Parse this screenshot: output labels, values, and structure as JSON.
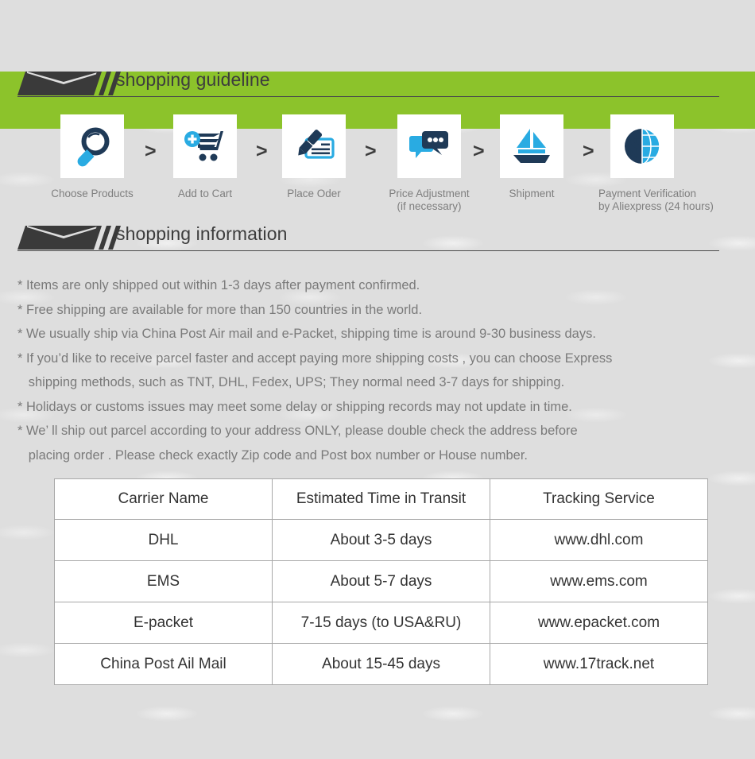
{
  "theme": {
    "banner_color": "#8CC32B",
    "page_background": "#dedede",
    "accent_dark": "#3a3a3a",
    "icon_dark": "#1F3A57",
    "icon_blue": "#29ABE2"
  },
  "banner": {
    "name": "green-header-banner"
  },
  "guideline": {
    "title": "shopping guideline",
    "separator": ">",
    "steps": [
      {
        "icon": "magnifier-icon",
        "label_line1": "Choose Products",
        "label_line2": ""
      },
      {
        "icon": "add-to-cart-icon",
        "label_line1": "Add to Cart",
        "label_line2": ""
      },
      {
        "icon": "pen-check-icon",
        "label_line1": "Place Oder",
        "label_line2": ""
      },
      {
        "icon": "chat-bubbles-icon",
        "label_line1": "Price Adjustment",
        "label_line2": "(if necessary)"
      },
      {
        "icon": "sailboat-icon",
        "label_line1": "Shipment",
        "label_line2": ""
      },
      {
        "icon": "dollar-globe-icon",
        "label_line1": "Payment Verification",
        "label_line2": "by  Aliexpress (24 hours)"
      }
    ]
  },
  "information": {
    "title": "shopping information",
    "lines": [
      "* Items are only shipped out within 1-3 days after payment confirmed.",
      "* Free shipping are available for more than 150 countries in the world.",
      "* We usually ship via China Post Air mail and e-Packet, shipping time is around 9-30 business days.",
      "* If you’d like to receive parcel faster and accept paying more shipping costs , you can choose Express",
      "   shipping methods, such as TNT, DHL, Fedex, UPS; They normal need 3-7 days for shipping.",
      "* Holidays or customs issues may meet some delay or shipping records may not update in time.",
      "* We’ ll ship out parcel according to your address ONLY, please double check the address before",
      "   placing order . Please check exactly Zip code and Post box number or House number."
    ]
  },
  "carrier_table": {
    "headers": [
      "Carrier Name",
      "Estimated Time in Transit",
      "Tracking Service"
    ],
    "rows": [
      [
        "DHL",
        "About 3-5 days",
        "www.dhl.com"
      ],
      [
        "EMS",
        "About 5-7 days",
        "www.ems.com"
      ],
      [
        "E-packet",
        "7-15 days (to USA&RU)",
        "www.epacket.com"
      ],
      [
        "China Post Ail Mail",
        "About 15-45 days",
        "www.17track.net"
      ]
    ]
  }
}
